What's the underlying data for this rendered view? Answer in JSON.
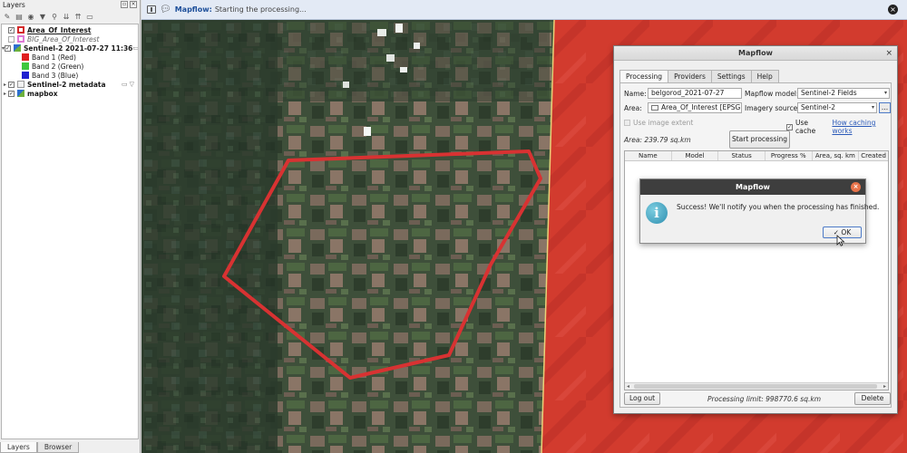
{
  "layers_panel": {
    "title": "Layers",
    "layers": [
      {
        "name": "Area_Of_Interest",
        "checked": true,
        "style": "bold-underline",
        "symbol": "aoi"
      },
      {
        "name": "BIG_Area_Of_Interest",
        "checked": false,
        "style": "italic",
        "symbol": "big"
      },
      {
        "name": "Sentinel-2 2021-07-27 11:36",
        "checked": true,
        "style": "bold",
        "symbol": "raster"
      },
      {
        "name": "Band 1 (Red)",
        "symbol": "red"
      },
      {
        "name": "Band 2 (Green)",
        "symbol": "green"
      },
      {
        "name": "Band 3 (Blue)",
        "symbol": "blue"
      },
      {
        "name": "Sentinel-2 metadata",
        "checked": true,
        "style": "bold",
        "symbol": "vec"
      },
      {
        "name": "mapbox",
        "checked": true,
        "style": "bold",
        "symbol": "raster"
      }
    ],
    "tabs": [
      "Layers",
      "Browser"
    ]
  },
  "message_bar": {
    "title": "Mapflow:",
    "text": "Starting the processing..."
  },
  "mapflow_dialog": {
    "title": "Mapflow",
    "tabs": [
      "Processing",
      "Providers",
      "Settings",
      "Help"
    ],
    "name_label": "Name:",
    "name_value": "belgorod_2021-07-27",
    "model_label": "Mapflow model:",
    "model_value": "Sentinel-2 Fields",
    "area_label": "Area:",
    "area_value": "Area_Of_Interest [EPSG:",
    "imagery_label": "Imagery source:",
    "imagery_value": "Sentinel-2",
    "browse_label": "...",
    "use_image_extent": "Use image extent",
    "use_cache": "Use cache",
    "caching_link": "How caching works",
    "area_info": "Area: 239.79 sq.km",
    "start_button": "Start processing",
    "table_columns": [
      "Name",
      "Model",
      "Status",
      "Progress %",
      "Area, sq. km",
      "Created"
    ],
    "logout_button": "Log out",
    "processing_limit": "Processing limit: 998770.6 sq.km",
    "delete_button": "Delete"
  },
  "success_dialog": {
    "title": "Mapflow",
    "message": "Success! We'll notify you when the processing has finished.",
    "ok_label": "OK"
  },
  "colors": {
    "aoi_outline": "#d83232",
    "outside_fill": "#d23b2e",
    "message_title": "#1d4f9a",
    "link": "#2a59b8"
  }
}
